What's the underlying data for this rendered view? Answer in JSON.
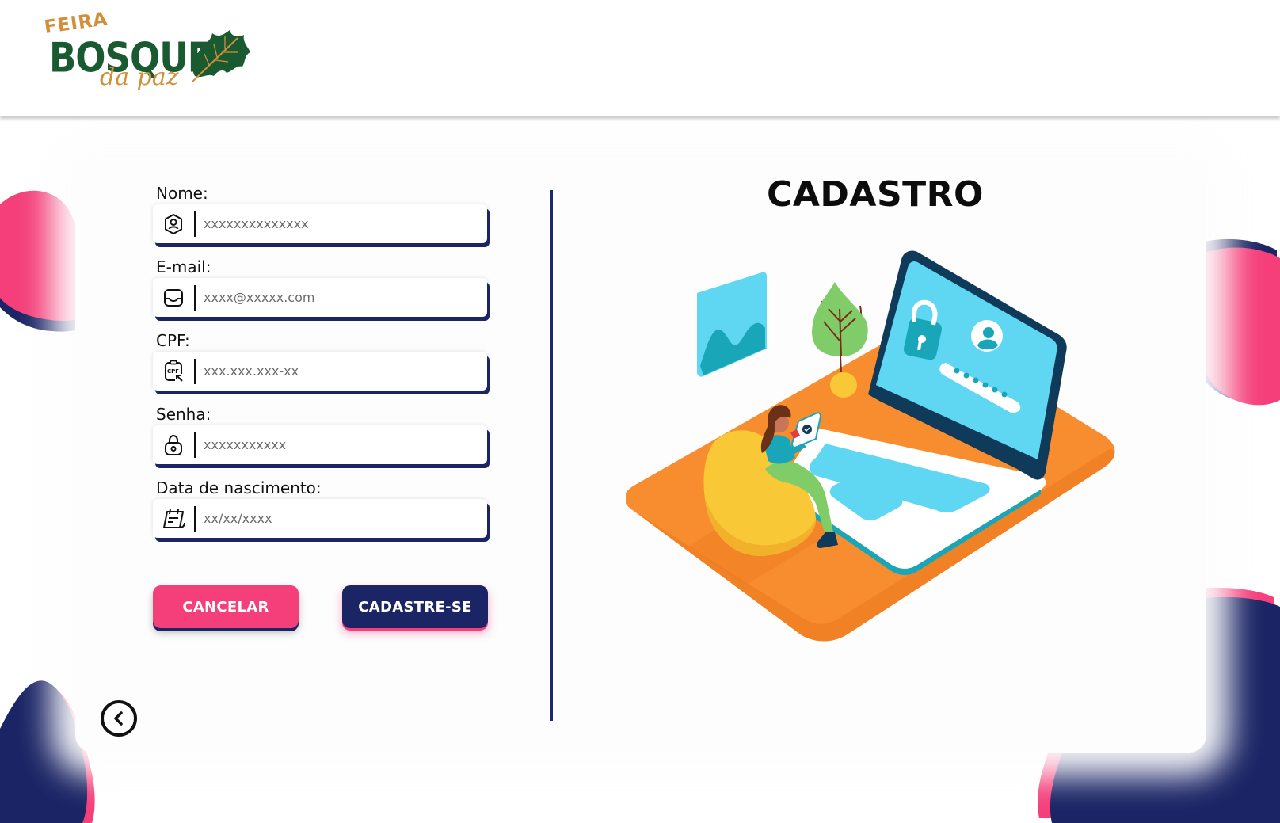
{
  "header": {
    "logo": {
      "feira": "FEIRA",
      "bosque": "BOSQUE",
      "dapaz": "da paz"
    }
  },
  "form": {
    "fields": [
      {
        "label": "Nome:",
        "placeholder": "xxxxxxxxxxxxxx",
        "icon": "user-hexagon-icon"
      },
      {
        "label": "E-mail:",
        "placeholder": "xxxx@xxxxx.com",
        "icon": "inbox-icon"
      },
      {
        "label": "CPF:",
        "placeholder": "xxx.xxx.xxx-xx",
        "icon": "cpf-document-icon"
      },
      {
        "label": "Senha:",
        "placeholder": "xxxxxxxxxxx",
        "icon": "lock-icon"
      },
      {
        "label": "Data de nascimento:",
        "placeholder": "xx/xx/xxxx",
        "icon": "calendar-icon"
      }
    ],
    "cancel_label": "CANCELAR",
    "signup_label": "CADASTRE-SE"
  },
  "page": {
    "title": "CADASTRO"
  },
  "colors": {
    "navy": "#1b2565",
    "pink": "#f53f7a",
    "orange": "#f78d2e",
    "cyan": "#5fd6f2"
  }
}
